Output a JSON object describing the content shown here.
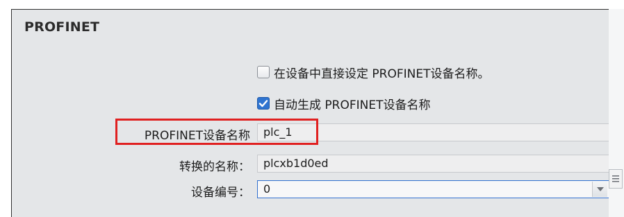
{
  "panel": {
    "title": "PROFINET"
  },
  "options": {
    "direct_set": {
      "label": "在设备中直接设定 PROFINET设备名称。",
      "checked": false
    },
    "auto_generate": {
      "label": "自动生成 PROFINET设备名称",
      "checked": true
    }
  },
  "fields": {
    "profinet_name": {
      "label": "PROFINET设备名称",
      "value": "plc_1"
    },
    "converted_name": {
      "label": "转换的名称：",
      "value": "plcxb1d0ed"
    },
    "device_number": {
      "label": "设备编号：",
      "value": "0"
    }
  },
  "colors": {
    "panel_bg": "#e4e6e8",
    "checkbox_checked": "#2f74d0",
    "highlight_red": "#e02020",
    "select_border": "#2f6fcf"
  },
  "icons": {
    "checkmark": "check-icon",
    "dropdown": "chevron-down-icon",
    "scroll_handle": "menu-lines-icon"
  }
}
